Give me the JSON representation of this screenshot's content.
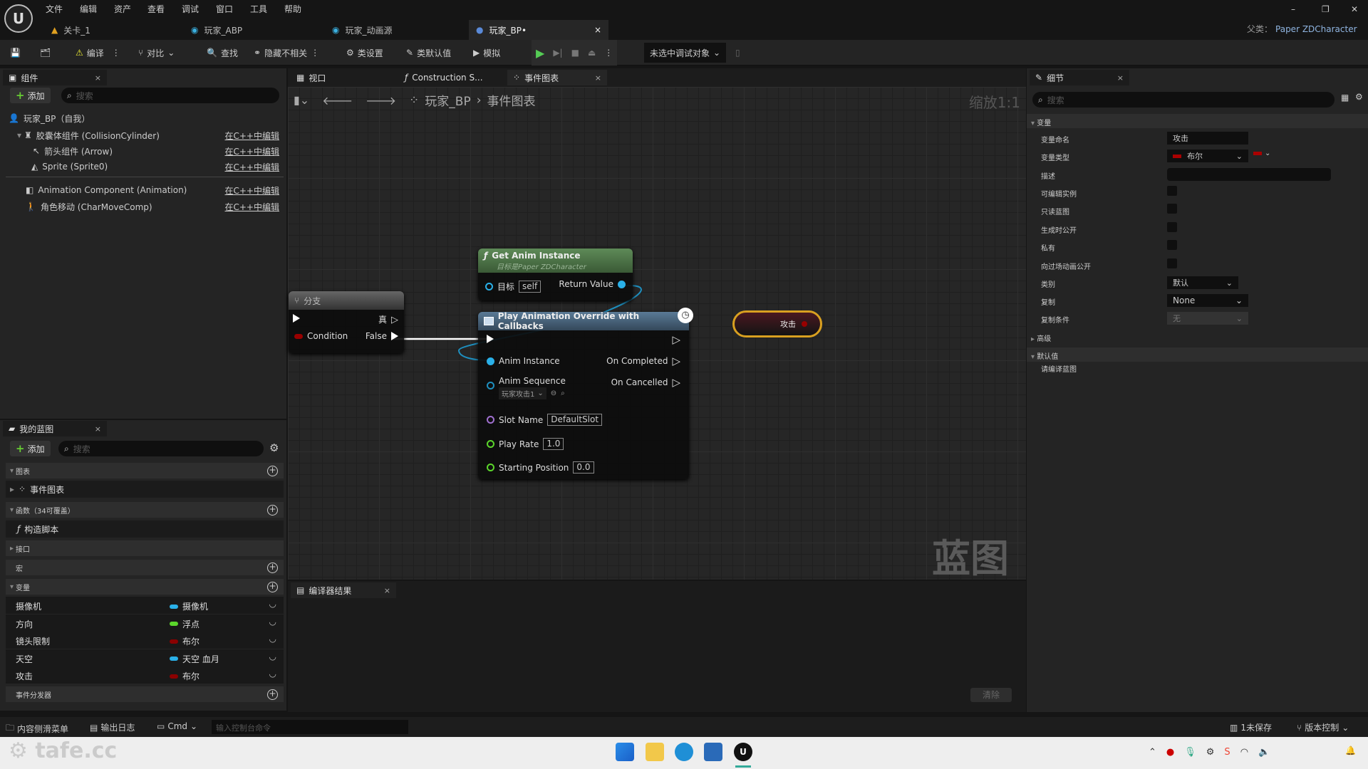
{
  "app": {
    "logo": "U",
    "menu": [
      "文件",
      "编辑",
      "资产",
      "查看",
      "调试",
      "窗口",
      "工具",
      "帮助"
    ],
    "tabs": [
      {
        "label": "关卡_1",
        "icon": "level-icon"
      },
      {
        "label": "玩家_ABP",
        "icon": "anim-blueprint-icon"
      },
      {
        "label": "玩家_动画源",
        "icon": "anim-source-icon"
      },
      {
        "label": "玩家_BP•",
        "icon": "blueprint-icon",
        "active": true
      }
    ],
    "parent_label": "父类：",
    "parent_value": "Paper ZDCharacter"
  },
  "toolbar": {
    "compile": "编译",
    "diff": "对比",
    "find": "查找",
    "hide_unrelated": "隐藏不相关",
    "class_settings": "类设置",
    "class_defaults": "类默认值",
    "simulate": "模拟",
    "debug_target": "未选中调试对象"
  },
  "components": {
    "tab": "组件",
    "add": "添加",
    "search_placeholder": "搜索",
    "items": [
      {
        "label": "玩家_BP（自我）"
      },
      {
        "label": "胶囊体组件 (CollisionCylinder)",
        "link": "在C++中编辑"
      },
      {
        "label": "箭头组件 (Arrow)",
        "link": "在C++中编辑"
      },
      {
        "label": "Sprite (Sprite0)",
        "link": "在C++中编辑"
      },
      {
        "label": "Animation Component (Animation)",
        "link": "在C++中编辑"
      },
      {
        "label": "角色移动 (CharMoveComp)",
        "link": "在C++中编辑"
      }
    ]
  },
  "my_blueprint": {
    "tab": "我的蓝图",
    "add": "添加",
    "search_placeholder": "搜索",
    "graphs": "图表",
    "event_graph": "事件图表",
    "functions": "函数（34可覆盖）",
    "construction": "构造脚本",
    "interfaces": "接口",
    "macros": "宏",
    "variables": "变量",
    "dispatchers": "事件分发器",
    "vars": [
      {
        "name": "摄像机",
        "type": "摄像机",
        "color": "#2ab0e8"
      },
      {
        "name": "方向",
        "type": "浮点",
        "color": "#5bd62b"
      },
      {
        "name": "镜头限制",
        "type": "布尔",
        "color": "#8a0000"
      },
      {
        "name": "天空",
        "type": "天空 血月",
        "color": "#2ab0e8"
      },
      {
        "name": "攻击",
        "type": "布尔",
        "color": "#8a0000"
      }
    ]
  },
  "graph": {
    "tabs": [
      "视口",
      "Construction S...",
      "事件图表"
    ],
    "breadcrumb_root": "玩家_BP",
    "breadcrumb_leaf": "事件图表",
    "zoom": "缩放1:1",
    "watermark": "蓝图",
    "branch": {
      "title": "分支",
      "true": "真",
      "condition": "Condition",
      "false": "False"
    },
    "get_anim": {
      "title": "Get Anim Instance",
      "subtitle": "目标是Paper ZDCharacter",
      "target": "目标",
      "target_value": "self",
      "return": "Return Value"
    },
    "play_anim": {
      "title": "Play Animation Override with Callbacks",
      "anim_instance": "Anim Instance",
      "anim_sequence": "Anim Sequence",
      "sequence_value": "玩家攻击1",
      "slot_name": "Slot Name",
      "slot_value": "DefaultSlot",
      "play_rate": "Play Rate",
      "play_rate_value": "1.0",
      "start_pos": "Starting Position",
      "start_pos_value": "0.0",
      "on_completed": "On Completed",
      "on_cancelled": "On Cancelled"
    },
    "var_node": {
      "label": "攻击"
    }
  },
  "compiler": {
    "tab": "编译器结果",
    "clear": "清除"
  },
  "details": {
    "tab": "细节",
    "search_placeholder": "搜索",
    "section_variable": "变量",
    "var_name_label": "变量命名",
    "var_name": "攻击",
    "var_type_label": "变量类型",
    "var_type": "布尔",
    "desc_label": "描述",
    "checkboxes": [
      "可编辑实例",
      "只读蓝图",
      "生成时公开",
      "私有",
      "向过场动画公开"
    ],
    "category_label": "类别",
    "category": "默认",
    "replication_label": "复制",
    "replication": "None",
    "rep_cond_label": "复制条件",
    "rep_cond": "无",
    "advanced": "高级",
    "defaults": "默认值",
    "compile_hint": "请编译蓝图"
  },
  "status": {
    "content_drawer": "内容侧滑菜单",
    "output_log": "输出日志",
    "cmd": "Cmd",
    "console_placeholder": "输入控制台命令",
    "unsaved": "1未保存",
    "source_control": "版本控制"
  },
  "watermark_logo": "tafe.cc",
  "colors": {
    "accent_blue": "#2ab0e8",
    "bool_red": "#8a0000",
    "float_green": "#5bd62b",
    "exec_white": "#ffffff",
    "func_header": "#4f7a4a",
    "call_header": "#3f5f7a",
    "var_node_border": "#d9a020"
  }
}
